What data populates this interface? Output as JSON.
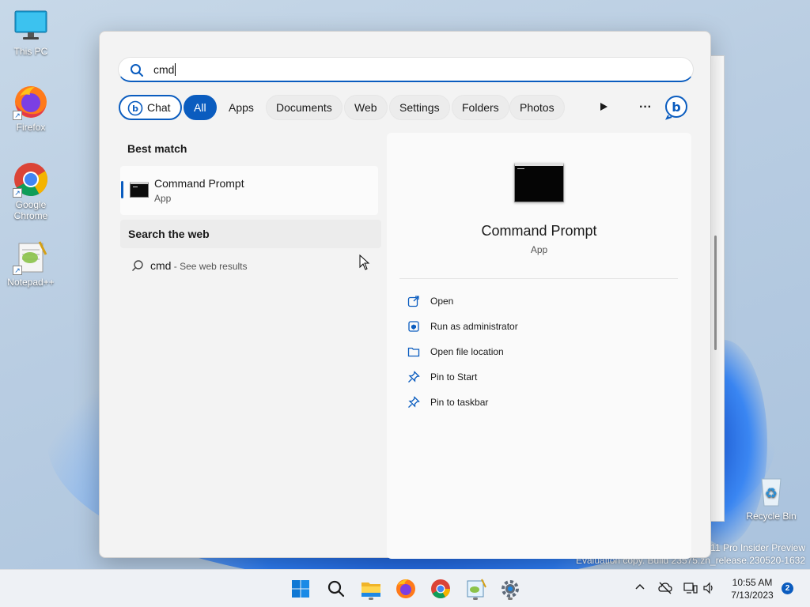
{
  "desktop": {
    "icons": [
      {
        "label": "This PC"
      },
      {
        "label": "Firefox"
      },
      {
        "label": "Google Chrome"
      },
      {
        "label": "Notepad++"
      },
      {
        "label": "Recycle Bin"
      }
    ],
    "watermark_line1": "11 Pro Insider Preview",
    "watermark_line2": "Evaluation copy. Build 23575.zn_release.230520-1632"
  },
  "search": {
    "query": "cmd",
    "filters": [
      {
        "label": "Chat",
        "icon": "bing-icon",
        "state": "outlined"
      },
      {
        "label": "All",
        "state": "selected"
      },
      {
        "label": "Apps"
      },
      {
        "label": "Documents"
      },
      {
        "label": "Web"
      },
      {
        "label": "Settings"
      },
      {
        "label": "Folders"
      },
      {
        "label": "Photos"
      }
    ],
    "more_icon": "play-icon",
    "ellipsis": "···",
    "bing_button_icon": "bing-icon"
  },
  "results": {
    "best_match_heading": "Best match",
    "best_match": {
      "title": "Command Prompt",
      "type": "App",
      "icon": "command-prompt-icon"
    },
    "web_heading": "Search the web",
    "web_item": {
      "query": "cmd",
      "suffix": " - See web results",
      "icon": "search-icon"
    }
  },
  "details": {
    "title": "Command Prompt",
    "type": "App",
    "actions": [
      {
        "label": "Open",
        "icon": "open-external-icon"
      },
      {
        "label": "Run as administrator",
        "icon": "shield-icon"
      },
      {
        "label": "Open file location",
        "icon": "folder-icon"
      },
      {
        "label": "Pin to Start",
        "icon": "pin-icon"
      },
      {
        "label": "Pin to taskbar",
        "icon": "pin-icon"
      }
    ]
  },
  "taskbar": {
    "apps": [
      "windows-start-icon",
      "search-icon",
      "file-explorer-icon",
      "firefox-icon",
      "chrome-icon",
      "notepadpp-icon",
      "settings-icon"
    ],
    "time": "10:55 AM",
    "date": "7/13/2023",
    "notification_count": "2"
  },
  "colors": {
    "accent": "#0a5cbf",
    "panel_bg": "#f3f3f3",
    "taskbar_bg": "#eef1f5"
  }
}
